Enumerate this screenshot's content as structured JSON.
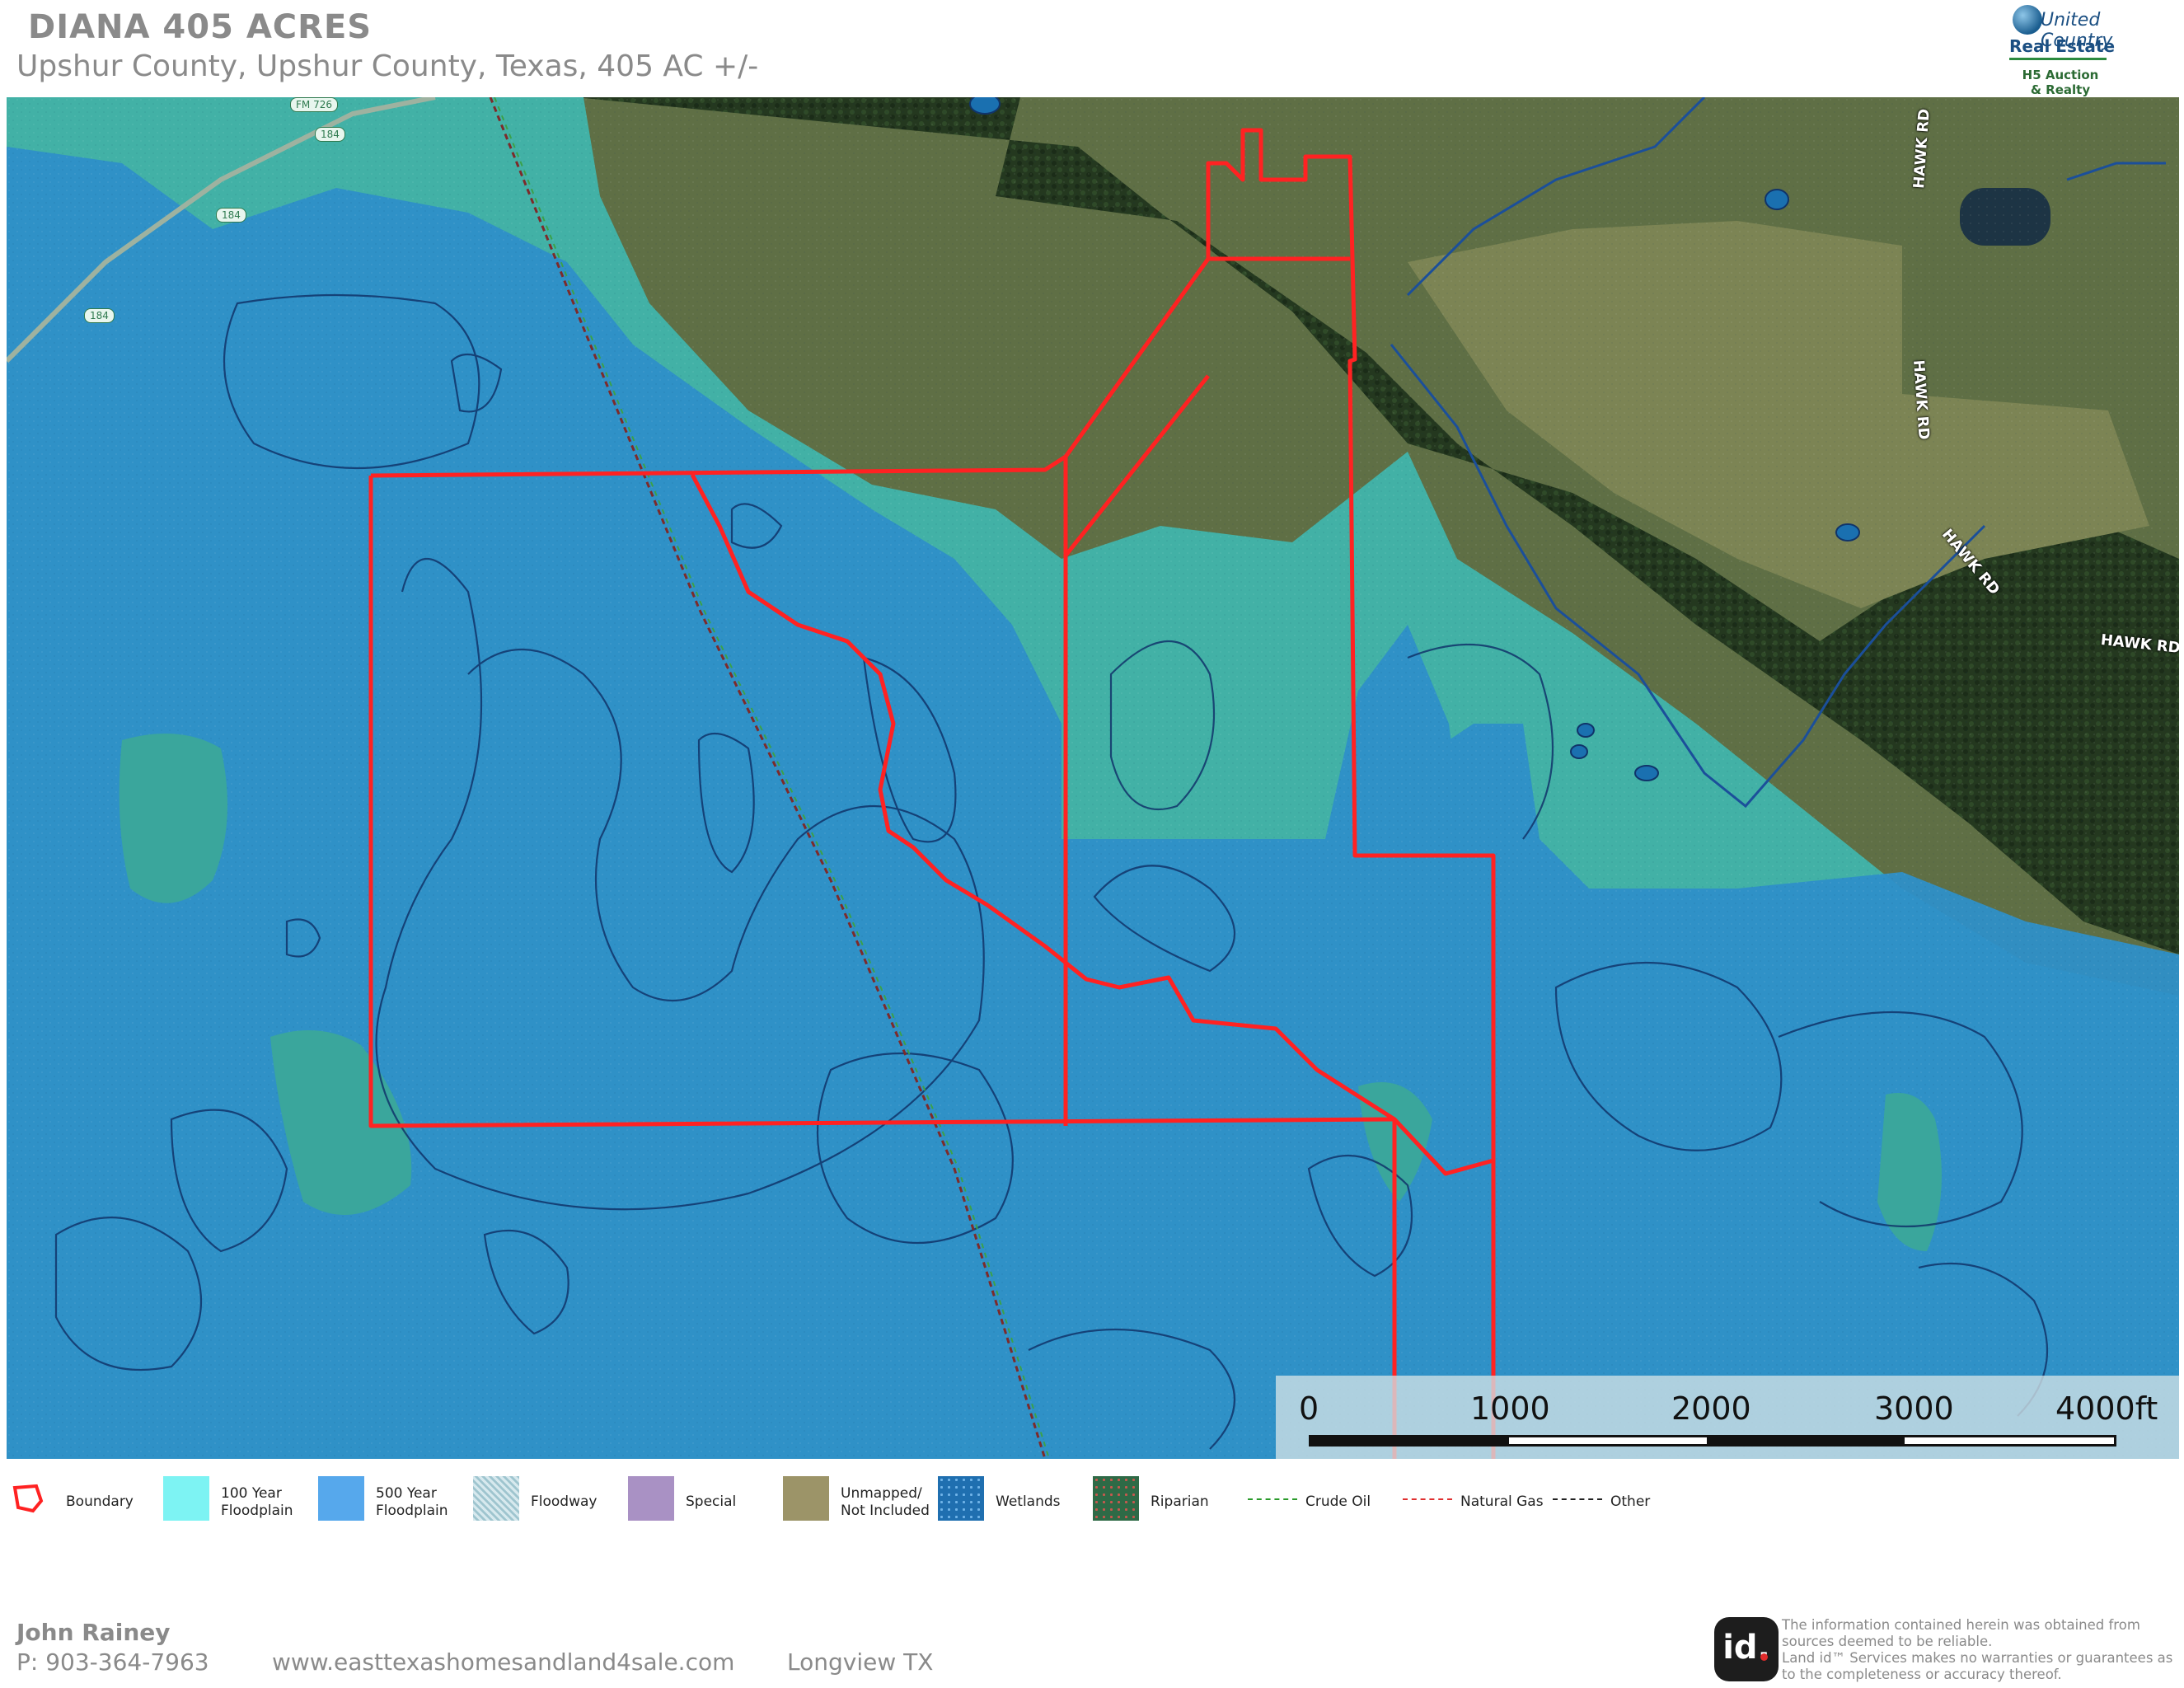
{
  "header": {
    "title": "DIANA 405 ACRES",
    "subtitle": "Upshur County, Upshur County, Texas, 405 AC +/-"
  },
  "logo": {
    "line1": "United Country",
    "line2": "Real Estate",
    "line3": "H5 Auction",
    "line4": "& Realty"
  },
  "map": {
    "road_labels": [
      {
        "text": "HAWK RD"
      },
      {
        "text": "HAWK RD"
      },
      {
        "text": "HAWK RD"
      },
      {
        "text": "HAWK RD"
      }
    ],
    "highway_shields": [
      "FM 726",
      "184",
      "184",
      "184"
    ],
    "colors": {
      "floodplain_500": "#2e8fc8",
      "floodplain_100": "#3fb8b0",
      "boundary": "#ff2020",
      "forest": "#263a22",
      "pasture": "#6d7548"
    }
  },
  "scale_bar": {
    "labels": [
      "0",
      "1000",
      "2000",
      "3000",
      "4000ft"
    ]
  },
  "legend": {
    "items": [
      {
        "label": "Boundary",
        "icon": "boundary-outline-icon"
      },
      {
        "label": "100 Year\nFloodplain",
        "color": "#7df3f3"
      },
      {
        "label": "500 Year\nFloodplain",
        "color": "#56a8ec"
      },
      {
        "label": "Floodway",
        "icon": "dotted-hatch-icon"
      },
      {
        "label": "Special",
        "color": "#a991c4"
      },
      {
        "label": "Unmapped/\nNot Included",
        "color": "#9c9468"
      },
      {
        "label": "Wetlands",
        "color": "#1f6fb0"
      },
      {
        "label": "Riparian",
        "color": "#2e6a46"
      },
      {
        "label": "Crude Oil",
        "color": "#2a9a2a"
      },
      {
        "label": "Natural Gas",
        "color": "#e03030"
      },
      {
        "label": "Other",
        "color": "#222222"
      }
    ]
  },
  "footer": {
    "agent_name": "John Rainey",
    "phone": "P: 903-364-7963",
    "website": "www.easttexashomesandland4sale.com",
    "city": "Longview TX",
    "id_logo": "id.",
    "disclaimer": "The information contained herein was obtained from sources deemed to be reliable.\n Land id™ Services makes no warranties or guarantees as to the completeness or accuracy thereof."
  }
}
